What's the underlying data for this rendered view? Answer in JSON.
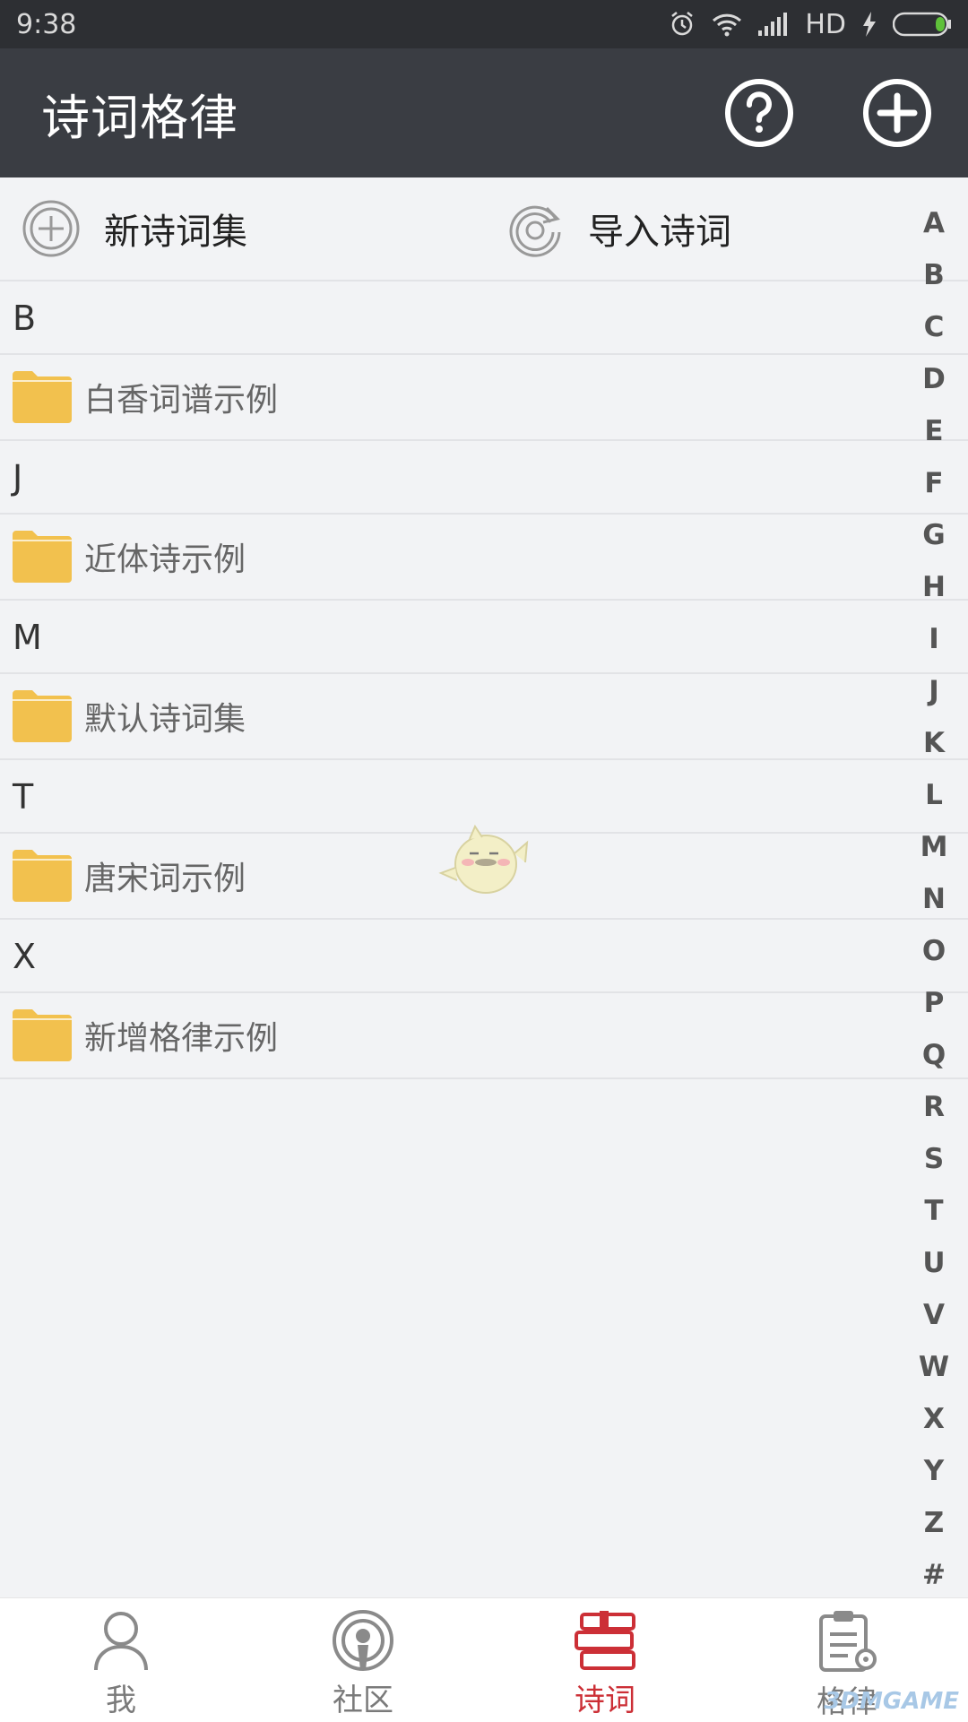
{
  "status_bar": {
    "time": "9:38",
    "network_label": "HD"
  },
  "app_bar": {
    "title": "诗词格律"
  },
  "quick_actions": {
    "new_collection": "新诗词集",
    "import": "导入诗词"
  },
  "sections": [
    {
      "letter": "B",
      "folders": [
        "白香词谱示例"
      ]
    },
    {
      "letter": "J",
      "folders": [
        "近体诗示例"
      ]
    },
    {
      "letter": "M",
      "folders": [
        "默认诗词集"
      ]
    },
    {
      "letter": "T",
      "folders": [
        "唐宋词示例"
      ]
    },
    {
      "letter": "X",
      "folders": [
        "新增格律示例"
      ]
    }
  ],
  "index_letters": [
    "A",
    "B",
    "C",
    "D",
    "E",
    "F",
    "G",
    "H",
    "I",
    "J",
    "K",
    "L",
    "M",
    "N",
    "O",
    "P",
    "Q",
    "R",
    "S",
    "T",
    "U",
    "V",
    "W",
    "X",
    "Y",
    "Z",
    "#"
  ],
  "bottom_nav": [
    {
      "label": "我",
      "icon": "person-icon",
      "active": false
    },
    {
      "label": "社区",
      "icon": "broadcast-icon",
      "active": false
    },
    {
      "label": "诗词",
      "icon": "books-icon",
      "active": true
    },
    {
      "label": "格律",
      "icon": "clipboard-gear-icon",
      "active": false
    }
  ],
  "watermark": "3DMGAME",
  "colors": {
    "appbar": "#3a3d43",
    "statusbar": "#2d2f33",
    "accent": "#cc2f36",
    "folder": "#f2c14e",
    "background": "#f2f3f5"
  }
}
